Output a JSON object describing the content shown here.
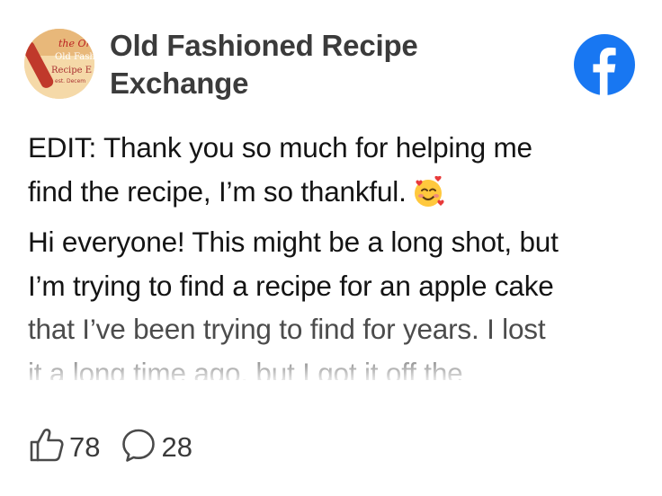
{
  "group": {
    "name": "Old Fashioned Recipe Exchange",
    "avatar_text": [
      "the Ori",
      "Old Fash",
      "Recipe E",
      "est. Decem"
    ]
  },
  "brand_icon": "facebook-icon",
  "brand_color": "#1877F2",
  "post": {
    "line1": "EDIT: Thank you so much for helping me",
    "line2": "find the recipe, I’m so thankful.",
    "line2_emoji": "smiling-face-with-hearts-icon",
    "line3": "Hi everyone! This might be a long shot, but",
    "line4": "I’m trying to find a recipe for an apple cake",
    "line5": "that I’ve been trying to find for years. I lost",
    "line6": "it a long time ago, but I got it off the"
  },
  "stats": {
    "likes": "78",
    "likes_icon": "thumbs-up-icon",
    "comments": "28",
    "comments_icon": "comment-bubble-icon"
  }
}
